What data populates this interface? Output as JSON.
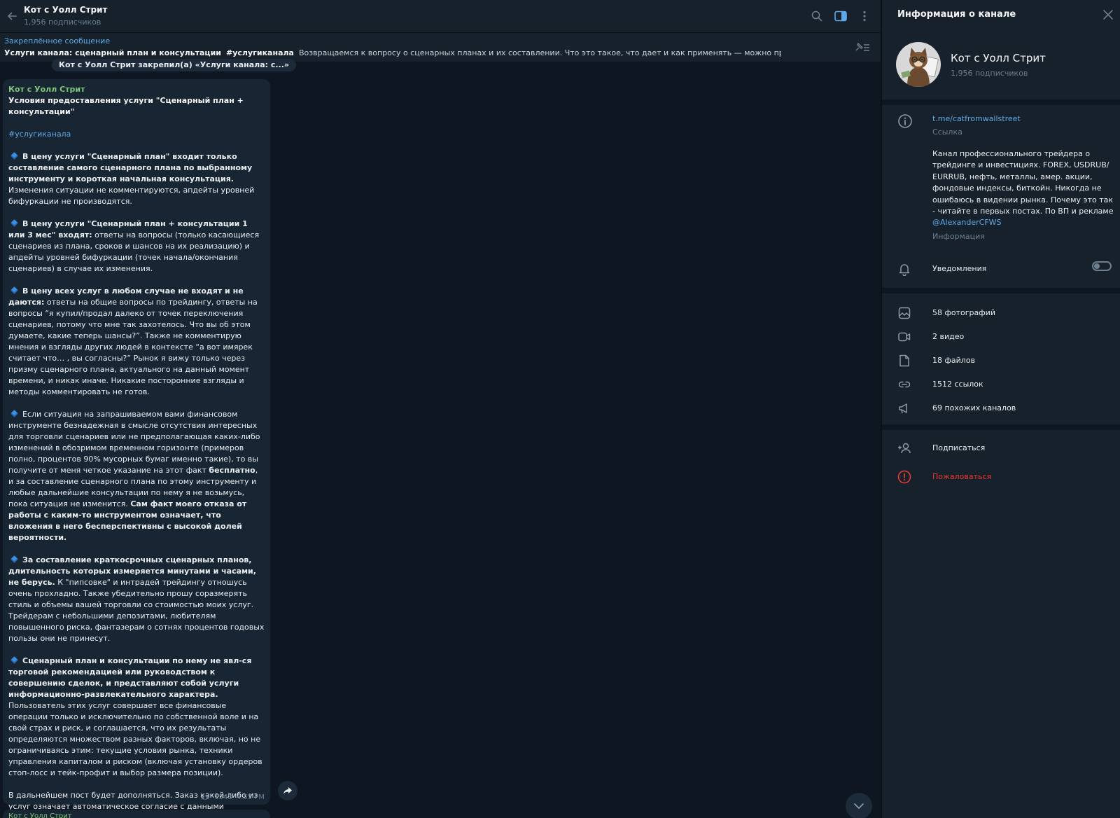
{
  "header": {
    "title": "Кот с Уолл Стрит",
    "subtitle": "1,956 подписчиков"
  },
  "pinned": {
    "label": "Закреплённое сообщение",
    "title": "Услуги канала: сценарный план и консультации",
    "hashtag": "#услугиканала",
    "preview": "Возвращаемся к вопросу о сценарных планах и их составлении. Что это такое, что дает и как применять — можно прочитать вот з"
  },
  "service_message": "Кот с Уолл Стрит закрепил(а) «Услуги канала: с...»",
  "message": {
    "author": "Кот с Уолл Стрит",
    "title": "Условия предоставления услуги \"Сценарный план + консультации\"",
    "hashtag": "#услугиканала",
    "p1_bold": "В цену услуги \"Сценарный план\" входит только составление самого сценарного плана по выбранному инструменту и короткая начальная консультация.",
    "p1_rest": " Изменения ситуации не комментируются, апдейты уровней бифуркации не производятся.",
    "p2_bold": "В цену услуги \"Сценарный план + консультации 1 или 3 мес\" входят:",
    "p2_rest": " ответы на вопросы (только касающиеся сценариев из плана, сроков и шансов на их реализацию) и апдейты уровней бифуркации (точек начала/окончания сценариев) в случае их изменения.",
    "p3_bold": "В цену всех услуг в любом случае не входят и не даются:",
    "p3_rest": " ответы на общие вопросы по трейдингу, ответы на вопросы “я купил/продал далеко от точек переключения сценариев, потому что мне так захотелось. Что вы об этом думаете, какие теперь шансы?”. Также не комментирую мнения и взгляды других людей в контексте “а вот имярек считает что… , вы согласны?” Рынок я вижу только через призму сценарного плана, актуального на данный момент времени, и никак иначе. Никакие посторонние взгляды и методы комментировать не готов.",
    "p4_a": "Если ситуация на запрашиваемом вами финансовом инструменте безнадежная в смысле отсутствия интересных для торговли сценариев или не предполагающая каких-либо изменений в обозримом временном горизонте (примеров полно, процентов 90% мусорных бумаг именно такие), то вы получите от меня четкое указание на этот факт ",
    "p4_b": "бесплатно",
    "p4_c": ", и за составление сценарного плана по этому инструменту и любые дальнейшие консультации по нему я не возьмусь, пока ситуация не изменится. ",
    "p4_d": "Сам факт моего отказа от работы с каким-то инструментом означает, что вложения в него бесперспективны с высокой долей вероятности.",
    "p5_bold": "За составление краткосрочных сценарных планов, длительность которых измеряется минутами и часами, не берусь.",
    "p5_rest": " К \"пипсовке\" и интрадей трейдингу отношусь очень прохладно. Также убедительно прошу соразмерять стиль и объемы вашей торговли со стоимостью моих услуг. Трейдерам с небольшими депозитами, любителям повышенного риска, фантазерам о сотнях процентов годовых пользы они не принесут.",
    "p6_bold": "Сценарный план и консультации по нему не явл-ся торговой рекомендацией или руководством к совершению сделок, и представляют собой услуги информационно-развлекательного характера.",
    "p6_rest": " Пользователь этих услуг совершает все финансовые операции только и исключительно по собственной воле и на свой страх и риск, и соглашается, что их результаты определяются множеством разных факторов, включая, но не ограничиваясь этим: текущие условия рынка, техники управления капиталом и риском (включая установку ордеров стоп-лосс и тейк-профит и выбор размера позиции).",
    "p7": "В дальнейшем пост будет дополняться. Заказ какой-либо из услуг означает автоматическое согласие с данными условиями.",
    "views": "1548",
    "time": "4:55 PM"
  },
  "next_message_author": "Кот с Уолл Стрит",
  "panel": {
    "title": "Информация о канале",
    "name": "Кот с Уолл Стрит",
    "subscribers": "1,956 подписчиков",
    "link": "t.me/catfromwallstreet",
    "link_label": "Ссылка",
    "description": "Канал профессионального трейдера о трейдинге и инвестициях. FOREX, USDRUB/ EURRUB, нефть, металлы, амер. акции, фондовые индексы, биткойн. Никогда не ошибаюсь в видении рынка. Почему это так - читайте в первых постах. По ВП и рекламе ",
    "mention": "@AlexanderCFWS",
    "info_label": "Информация",
    "notifications": "Уведомления",
    "notifications_on": false,
    "media": [
      {
        "label": "58 фотографий",
        "icon": "photo-icon"
      },
      {
        "label": "2 видео",
        "icon": "video-icon"
      },
      {
        "label": "18 файлов",
        "icon": "file-icon"
      },
      {
        "label": "1512 ссылок",
        "icon": "link-icon"
      },
      {
        "label": "69 похожих каналов",
        "icon": "megaphone-icon"
      }
    ],
    "subscribe": "Подписаться",
    "report": "Пожаловаться"
  },
  "colors": {
    "background": "#0e1621",
    "panel": "#17212b",
    "bubble": "#182533",
    "accent": "#5eaae8",
    "author": "#7ec779",
    "danger": "#e53935"
  }
}
